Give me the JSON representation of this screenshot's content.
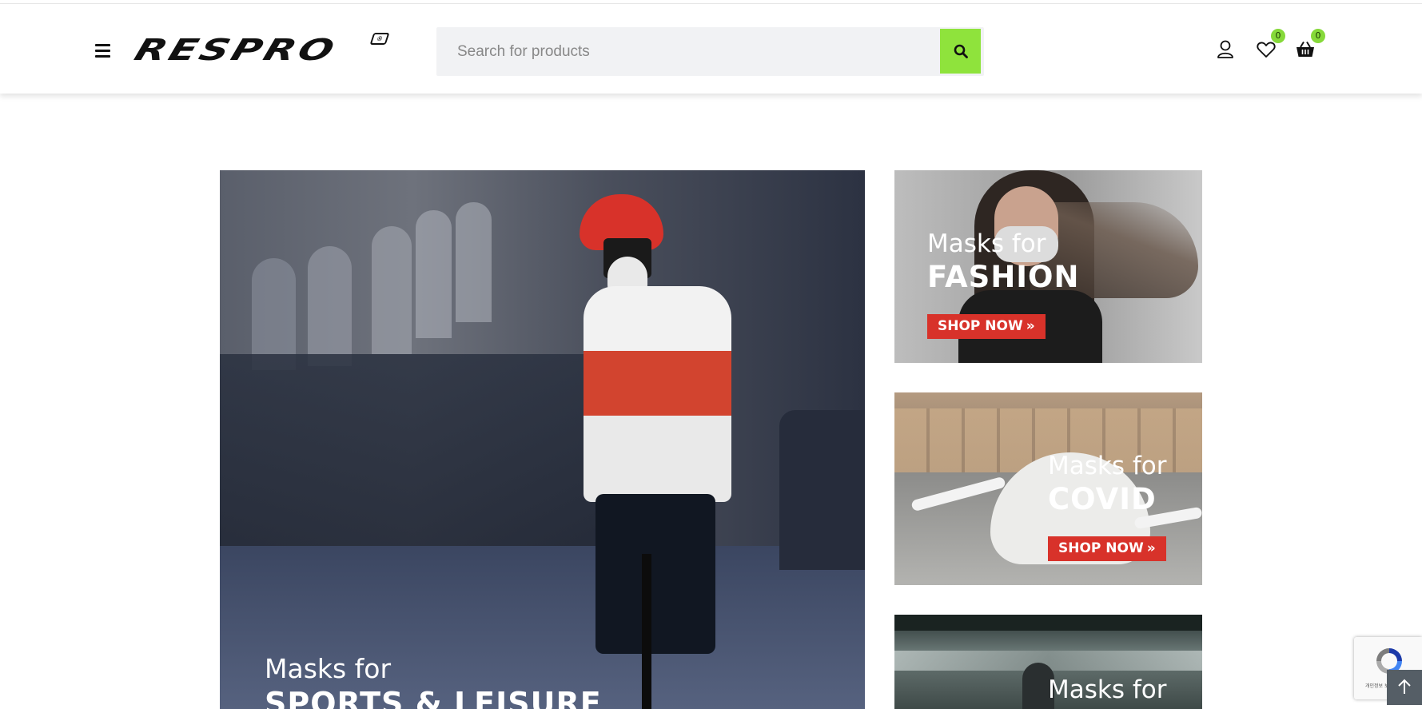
{
  "header": {
    "logo_text": "RESPRO",
    "logo_badge": "®",
    "search": {
      "placeholder": "Search for products"
    },
    "wishlist_count": "0",
    "cart_count": "0"
  },
  "banners": {
    "main": {
      "line1": "Masks for",
      "line2": "SPORTS & LEISURE"
    },
    "fashion": {
      "line1": "Masks for",
      "line2": "FASHION",
      "button": "SHOP NOW"
    },
    "covid": {
      "line1": "Masks for",
      "line2": "COVID",
      "button": "SHOP NOW"
    },
    "transport": {
      "line1": "Masks for"
    }
  },
  "recaptcha": {
    "text": "개인정보 보호"
  },
  "colors": {
    "accent_green": "#8fe33c",
    "shop_red": "#d8322a"
  },
  "icons": [
    "menu-icon",
    "search-icon",
    "user-icon",
    "heart-icon",
    "basket-icon",
    "recaptcha-icon",
    "arrow-up-icon",
    "chevrons-right-icon"
  ]
}
